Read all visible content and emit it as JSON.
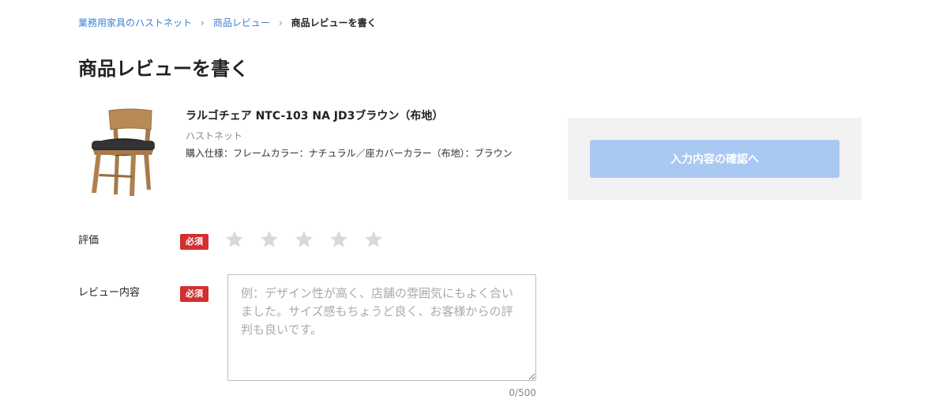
{
  "breadcrumb": {
    "items": [
      {
        "label": "業務用家具のハストネット"
      },
      {
        "label": "商品レビュー"
      }
    ],
    "current": "商品レビューを書く",
    "separator": "›"
  },
  "page_title": "商品レビューを書く",
  "product": {
    "name": "ラルゴチェア NTC-103 NA JD3ブラウン（布地）",
    "brand": "ハストネット",
    "spec": "購入仕様：フレームカラー：ナチュラル／座カバーカラー（布地）：ブラウン",
    "image": "chair-image"
  },
  "confirm_button": {
    "label": "入力内容の確認へ"
  },
  "rating": {
    "label": "評価",
    "required_badge": "必須",
    "value": 0,
    "max": 5,
    "icon": "star-icon"
  },
  "review": {
    "label": "レビュー内容",
    "required_badge": "必須",
    "placeholder": "例：デザイン性が高く、店舗の雰囲気にもよく合いました。サイズ感もちょうど良く、お客様からの評判も良いです。",
    "value": "",
    "char_count": "0/500"
  },
  "colors": {
    "link": "#3a7fd5",
    "required": "#d32f2f",
    "button_disabled": "#a9c8f2",
    "panel_bg": "#f2f2f2",
    "star_empty": "#d9d9d9"
  }
}
